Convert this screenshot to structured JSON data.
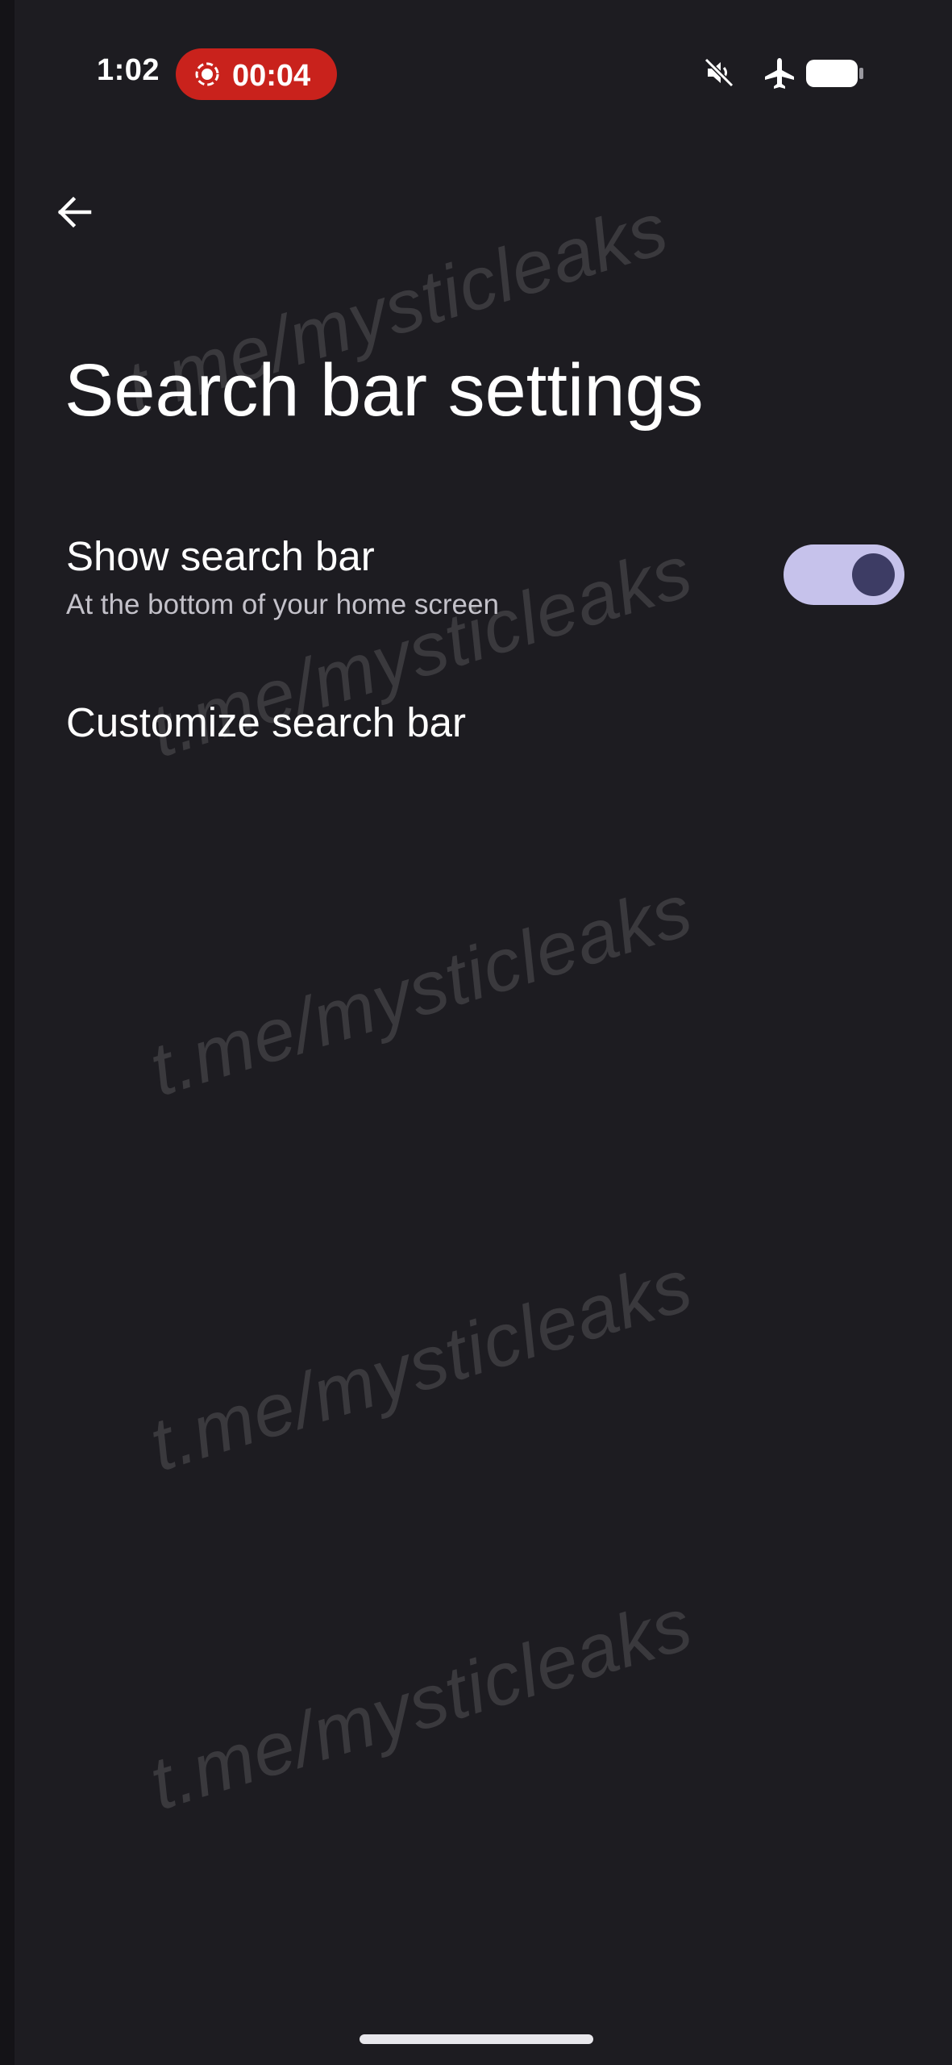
{
  "status_bar": {
    "time": "1:02",
    "recording_time": "00:04",
    "recording_color": "#c9221c",
    "icons": [
      "record-icon",
      "mute-icon",
      "airplane-icon",
      "battery-icon"
    ]
  },
  "app_bar": {
    "back_icon": "arrow-left-icon",
    "title": "Search bar settings"
  },
  "settings": {
    "show_search_bar": {
      "title": "Show search bar",
      "summary": "At the bottom of your home screen",
      "enabled": true
    },
    "customize_search_bar": {
      "title": "Customize search bar"
    }
  },
  "watermark": {
    "text": "t.me/mysticleaks"
  },
  "colors": {
    "background": "#1d1c21",
    "toggle_track": "#c6c2eb",
    "toggle_thumb": "#3d3c64"
  }
}
